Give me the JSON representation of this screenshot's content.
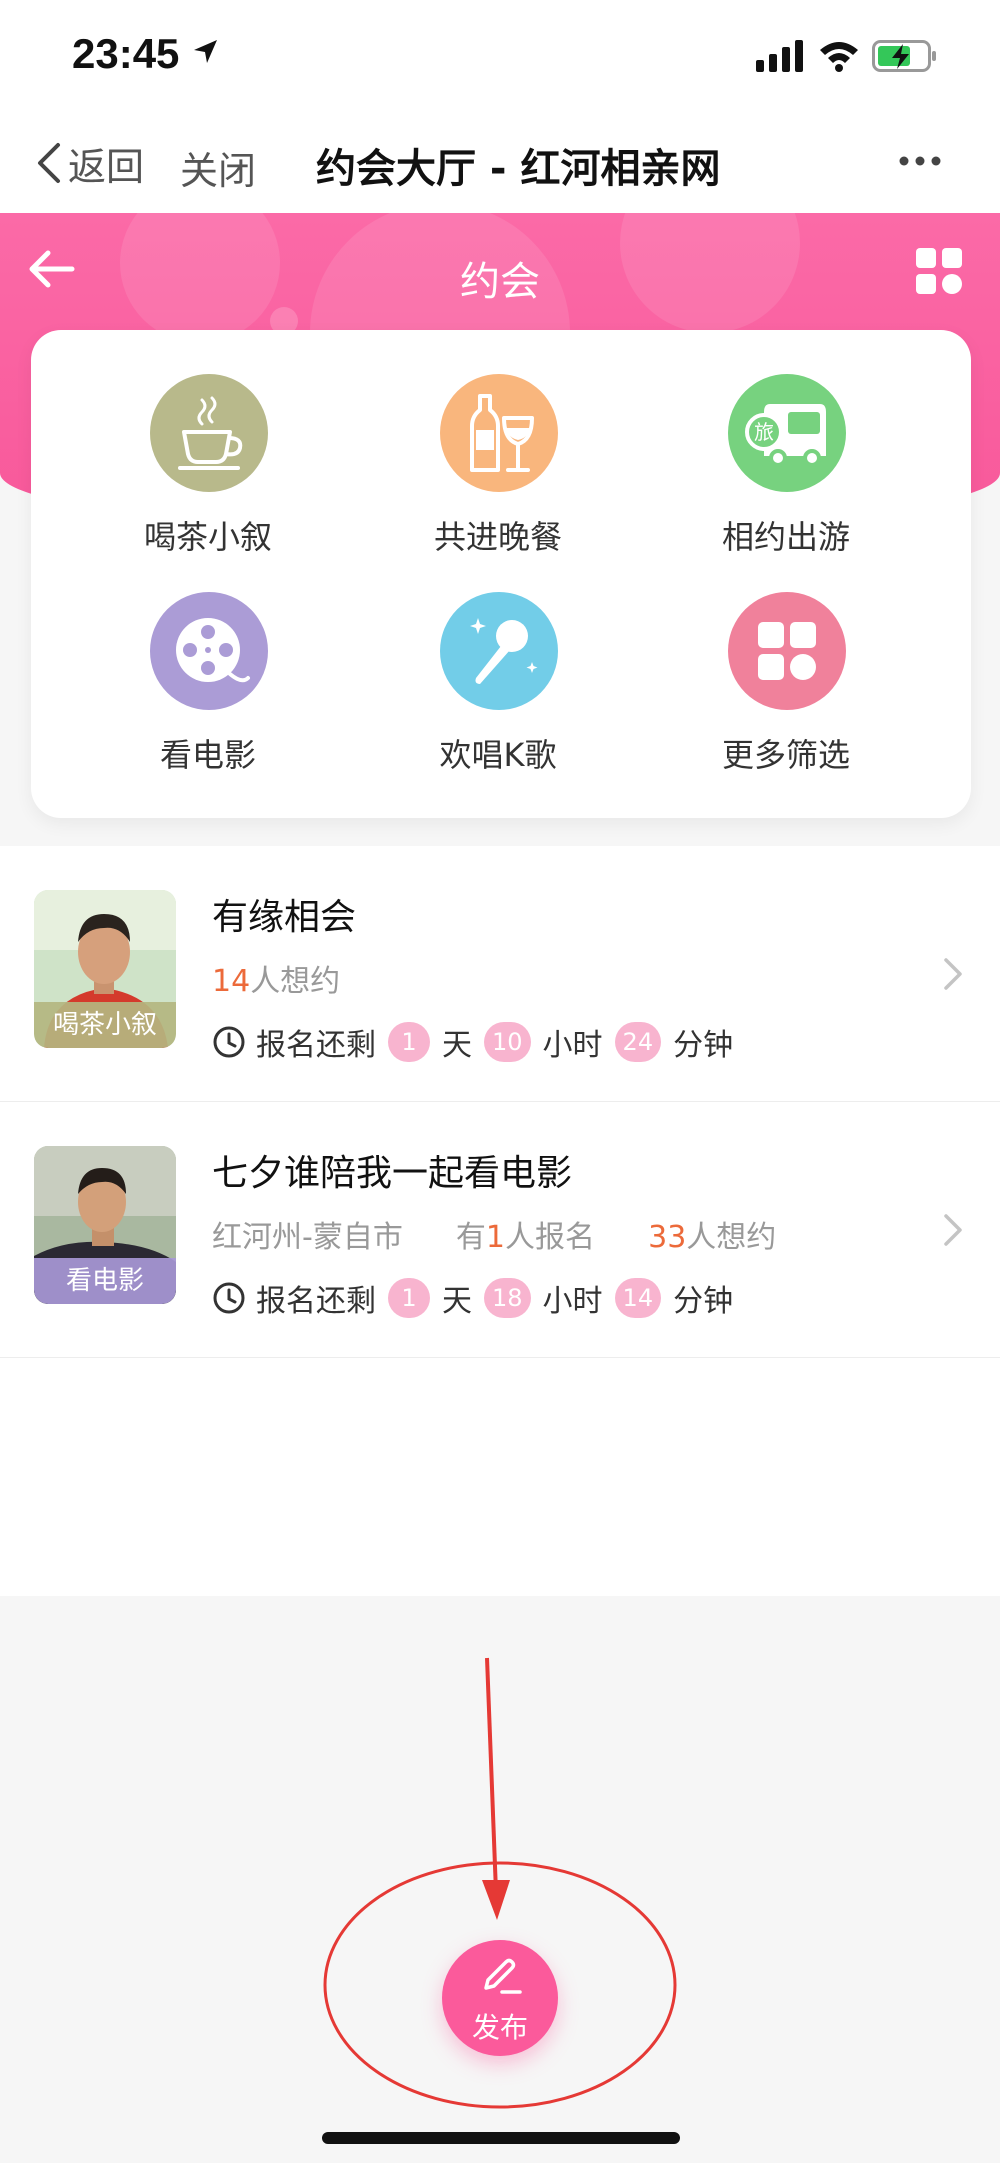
{
  "status_bar": {
    "time": "23:45"
  },
  "nav": {
    "back_label": "返回",
    "close_label": "关闭",
    "title": "约会大厅 - 红河相亲网"
  },
  "header": {
    "title": "约会"
  },
  "categories": [
    {
      "label": "喝茶小叙",
      "icon": "tea-cup-icon",
      "color": "#b8b98b"
    },
    {
      "label": "共进晚餐",
      "icon": "dinner-bottle-glass-icon",
      "color": "#f9b67d"
    },
    {
      "label": "相约出游",
      "icon": "travel-bus-icon",
      "color": "#77d27f"
    },
    {
      "label": "看电影",
      "icon": "film-reel-icon",
      "color": "#ab9cd6"
    },
    {
      "label": "欢唱K歌",
      "icon": "microphone-icon",
      "color": "#72cde8"
    },
    {
      "label": "更多筛选",
      "icon": "grid-more-icon",
      "color": "#f0819b"
    }
  ],
  "list": [
    {
      "title": "有缘相会",
      "thumb_tag": "喝茶小叙",
      "want_count": "14",
      "want_suffix": "人想约",
      "countdown_prefix": "报名还剩",
      "days": "1",
      "day_unit": "天",
      "hours": "10",
      "hour_unit": "小时",
      "minutes": "24",
      "minute_unit": "分钟"
    },
    {
      "title": "七夕谁陪我一起看电影",
      "thumb_tag": "看电影",
      "location": "红河州-蒙自市",
      "signup_prefix": "有",
      "signup_count": "1",
      "signup_suffix": "人报名",
      "want_count": "33",
      "want_suffix": "人想约",
      "countdown_prefix": "报名还剩",
      "days": "1",
      "day_unit": "天",
      "hours": "18",
      "hour_unit": "小时",
      "minutes": "14",
      "minute_unit": "分钟"
    }
  ],
  "publish": {
    "label": "发布"
  },
  "colors": {
    "brand_pink": "#f8589a",
    "highlight_orange": "#ec6a3a",
    "pill_pink": "#f8b4cf",
    "annotation_red": "#e53935"
  }
}
